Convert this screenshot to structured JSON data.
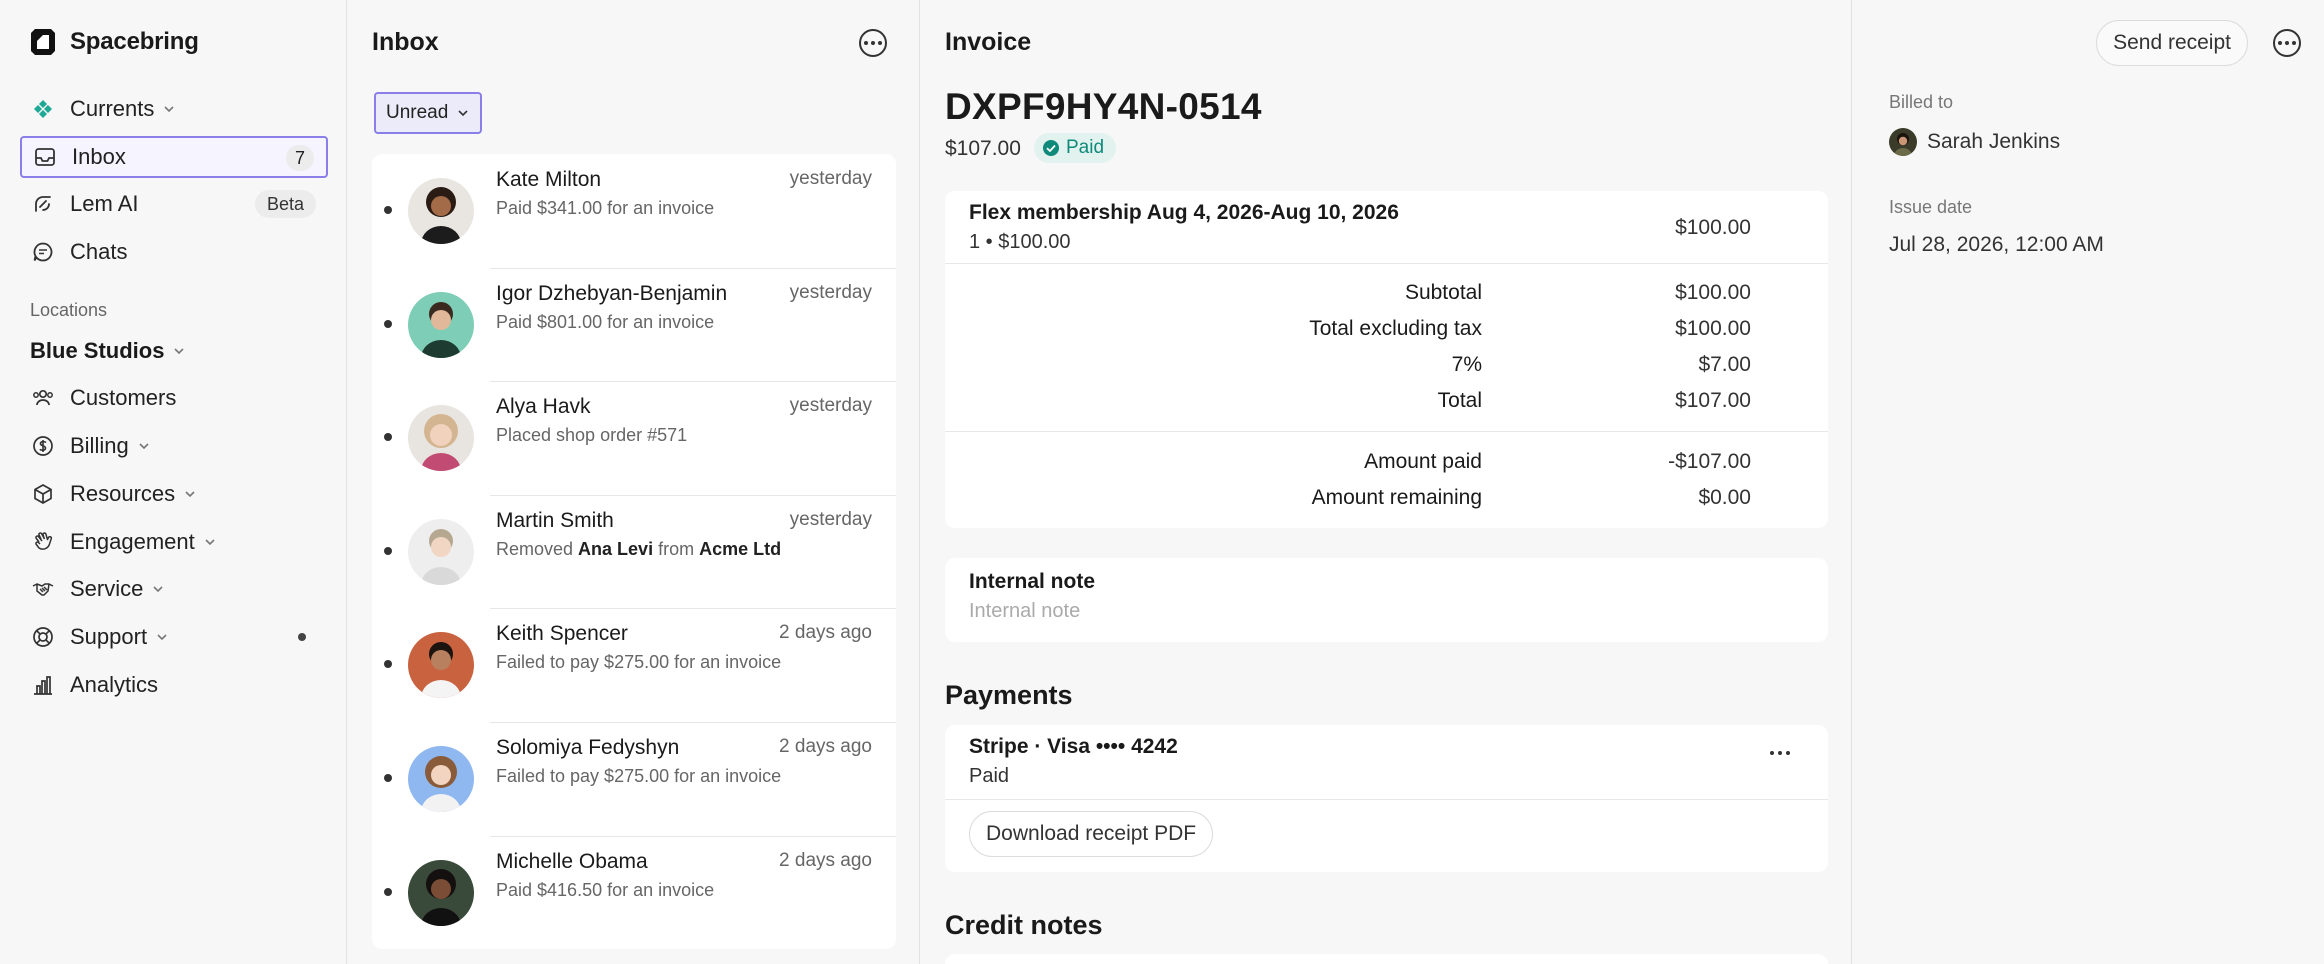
{
  "sidebar": {
    "brand": "Spacebring",
    "top_items": [
      {
        "label": "Currents"
      },
      {
        "label": "Inbox",
        "count": "7"
      },
      {
        "label": "Lem AI",
        "badge": "Beta"
      },
      {
        "label": "Chats"
      }
    ],
    "locations_label": "Locations",
    "location_name": "Blue Studios",
    "location_items": [
      {
        "label": "Customers"
      },
      {
        "label": "Billing"
      },
      {
        "label": "Resources"
      },
      {
        "label": "Engagement"
      },
      {
        "label": "Service"
      },
      {
        "label": "Support"
      },
      {
        "label": "Analytics"
      }
    ]
  },
  "inbox": {
    "title": "Inbox",
    "filter_label": "Unread",
    "messages": [
      {
        "name": "Kate Milton",
        "time": "yesterday",
        "preview": "Paid $341.00 for an invoice"
      },
      {
        "name": "Igor Dzhebyan-Benjamin",
        "time": "yesterday",
        "preview": "Paid $801.00 for an invoice"
      },
      {
        "name": "Alya Havk",
        "time": "yesterday",
        "preview": "Placed shop order #571"
      },
      {
        "name": "Martin Smith",
        "time": "yesterday",
        "preview_parts": [
          "Removed ",
          "Ana Levi",
          " from ",
          "Acme Ltd"
        ]
      },
      {
        "name": "Keith Spencer",
        "time": "2 days ago",
        "preview": "Failed to pay $275.00 for an invoice"
      },
      {
        "name": "Solomiya Fedyshyn",
        "time": "2 days ago",
        "preview": "Failed to pay $275.00 for an invoice"
      },
      {
        "name": "Michelle Obama",
        "time": "2 days ago",
        "preview": "Paid $416.50 for an invoice"
      }
    ]
  },
  "invoice": {
    "header_title": "Invoice",
    "send_receipt_label": "Send receipt",
    "number": "DXPF9HY4N-0514",
    "amount": "$107.00",
    "status": "Paid",
    "line_item": {
      "title": "Flex membership Aug 4, 2026-Aug 10, 2026",
      "qty_line": "1 • $100.00",
      "amount": "$100.00"
    },
    "summary": [
      {
        "label": "Subtotal",
        "value": "$100.00"
      },
      {
        "label": "Total excluding tax",
        "value": "$100.00"
      },
      {
        "label": "7%",
        "value": "$7.00"
      },
      {
        "label": "Total",
        "value": "$107.00"
      }
    ],
    "paid_summary": [
      {
        "label": "Amount paid",
        "value": "-$107.00"
      },
      {
        "label": "Amount remaining",
        "value": "$0.00"
      }
    ],
    "note_title": "Internal note",
    "note_placeholder": "Internal note",
    "payments_title": "Payments",
    "payment": {
      "method": "Stripe · Visa •••• 4242",
      "status": "Paid",
      "download_label": "Download receipt PDF"
    },
    "credit_notes_title": "Credit notes"
  },
  "details": {
    "billed_to_label": "Billed to",
    "billed_to_name": "Sarah Jenkins",
    "issue_date_label": "Issue date",
    "issue_date_value": "Jul 28, 2026, 12:00 AM"
  },
  "colors": {
    "accent": "#8a7ee8",
    "paid_bg": "#e2f2ef",
    "paid_text": "#0f8a7a",
    "currents_icon": "#1ea896"
  }
}
